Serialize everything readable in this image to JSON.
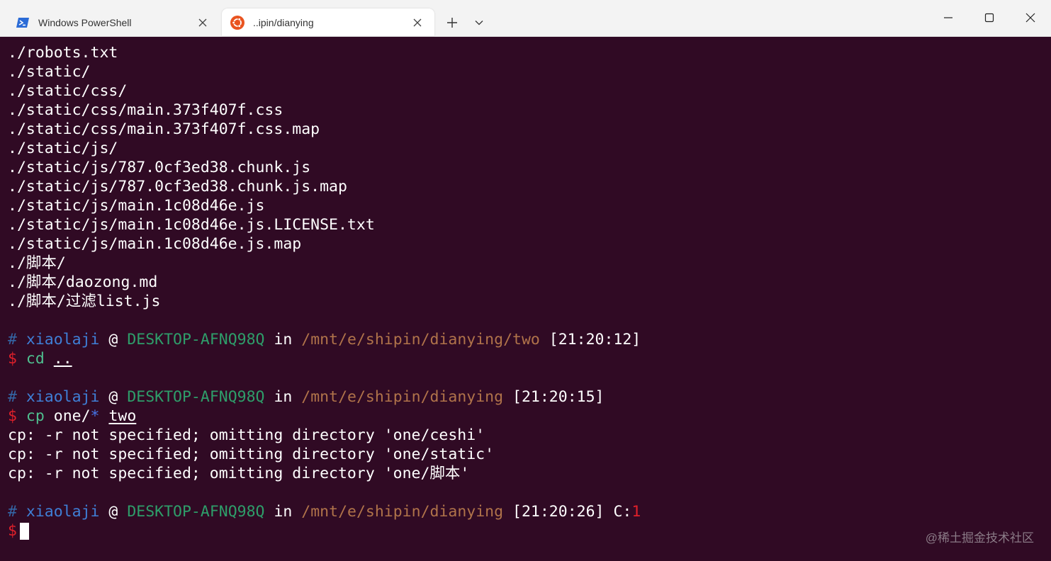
{
  "tabs": [
    {
      "title": "Windows PowerShell",
      "icon": "powershell-icon"
    },
    {
      "title": "..ipin/dianying",
      "icon": "ubuntu-icon"
    }
  ],
  "colors": {
    "terminal_bg": "#300a24",
    "user": "#3f7fd6",
    "host": "#2e9e6a",
    "path": "#b0734a",
    "error": "#e0202a"
  },
  "output1": [
    "./robots.txt",
    "./static/",
    "./static/css/",
    "./static/css/main.373f407f.css",
    "./static/css/main.373f407f.css.map",
    "./static/js/",
    "./static/js/787.0cf3ed38.chunk.js",
    "./static/js/787.0cf3ed38.chunk.js.map",
    "./static/js/main.1c08d46e.js",
    "./static/js/main.1c08d46e.js.LICENSE.txt",
    "./static/js/main.1c08d46e.js.map",
    "./脚本/",
    "./脚本/daozong.md",
    "./脚本/过滤list.js"
  ],
  "prompt1": {
    "hash": "#",
    "user": "xiaolaji",
    "at": "@",
    "host": "DESKTOP-AFNQ98Q",
    "in": "in",
    "path": "/mnt/e/shipin/dianying/two",
    "time": "[21:20:12]"
  },
  "cmd1": {
    "dollar": "$",
    "name": "cd",
    "arg": ".."
  },
  "prompt2": {
    "hash": "#",
    "user": "xiaolaji",
    "at": "@",
    "host": "DESKTOP-AFNQ98Q",
    "in": "in",
    "path": "/mnt/e/shipin/dianying",
    "time": "[21:20:15]"
  },
  "cmd2": {
    "dollar": "$",
    "name": "cp",
    "arg1": "one/",
    "glob": "*",
    "arg2": "two"
  },
  "output2": [
    "cp: -r not specified; omitting directory 'one/ceshi'",
    "cp: -r not specified; omitting directory 'one/static'",
    "cp: -r not specified; omitting directory 'one/脚本'"
  ],
  "prompt3": {
    "hash": "#",
    "user": "xiaolaji",
    "at": "@",
    "host": "DESKTOP-AFNQ98Q",
    "in": "in",
    "path": "/mnt/e/shipin/dianying",
    "time": "[21:20:26]",
    "code_label": "C:",
    "code": "1"
  },
  "cmd3": {
    "dollar": "$"
  },
  "watermark": "@稀土掘金技术社区"
}
